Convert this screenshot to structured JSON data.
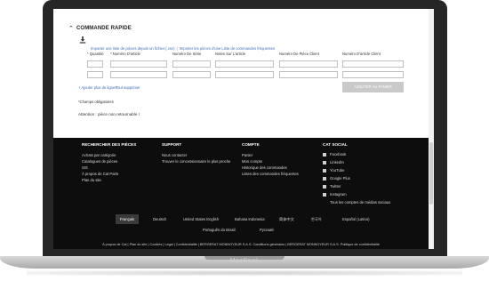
{
  "quick_order": {
    "title": "COMMANDE RAPIDE",
    "import_text_link": "Importer une liste de pièces depuis un fichier (.csv)",
    "import_favorites_link": "Importer les pièces d'une Liste de commandes fréquentes",
    "columns": [
      "Quantité",
      "Numéro D'article",
      "Numéro De Série",
      "Notes Sur L'article",
      "Numéro De Pièce Client",
      "Numéro D'article Client"
    ],
    "add_lines": "+ Ajouter plus de lignes",
    "delete_all": "Tout supprimer",
    "add_to_basket": "AJOUTER AU PANIER",
    "required_note": "*Champs obligatoires",
    "caution": "Attention : pièce non retournable !"
  },
  "footer": {
    "columns": [
      {
        "title": "RECHERCHER DES PIÈCES",
        "items": [
          "Achats par catégorie",
          "Catalogues de pièces",
          "SIS",
          "À propos de Cat Parts",
          "Plan du site"
        ]
      },
      {
        "title": "SUPPORT",
        "items": [
          "Nous contacter",
          "Trouver le concessionnaire le plus proche"
        ]
      },
      {
        "title": "COMPTE",
        "items": [
          "Panier",
          "Mon compte",
          "Historique des commandes",
          "Listes des commandes fréquentes"
        ]
      },
      {
        "title": "CAT SOCIAL",
        "items": [
          "Facebook",
          "LinkedIn",
          "YouTube",
          "Google Plus",
          "Twitter",
          "Instagram",
          "Tous les comptes de médias sociaux"
        ]
      }
    ],
    "languages": [
      "Français",
      "Deutsch",
      "United States English",
      "Bahasa Indonesia",
      "简体中文",
      "한국어",
      "Español (Latino)",
      "Português do Brasil",
      "Русский"
    ],
    "legal": "À propos de Cat  |  Plan du site  |  Cookies  |  Legal  |  Confidentialité  |  BERGERAT MONNOYEUR S.A.S. Conditions générales  |  BERGERAT MONNOYEUR S.A.S. Politique de confidentialité"
  },
  "device": {
    "brand": "MacBook"
  }
}
